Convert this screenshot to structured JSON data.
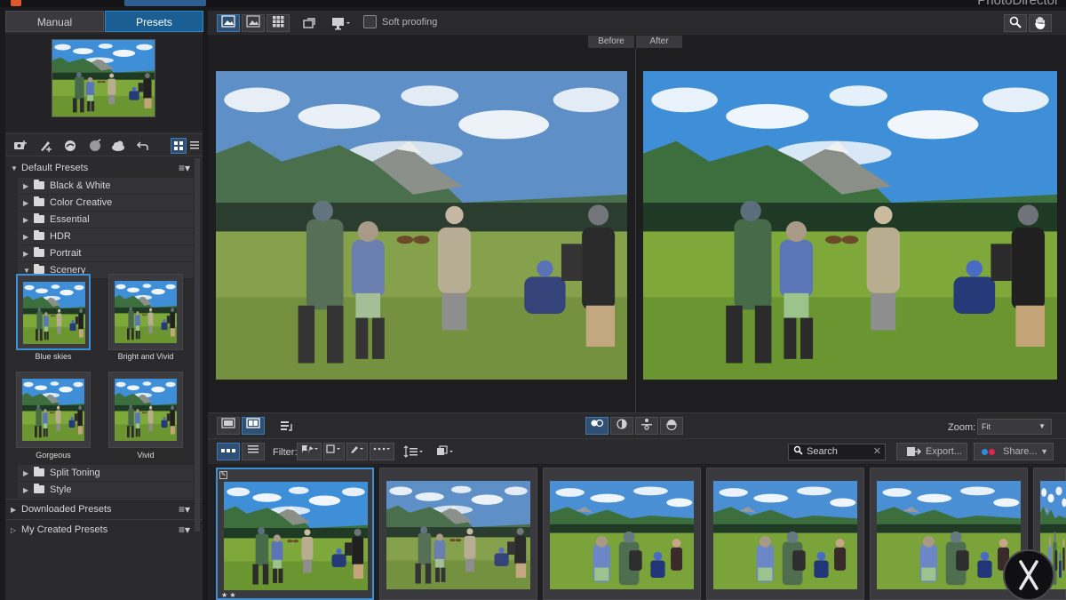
{
  "app": {
    "title": "PhotoDirector"
  },
  "left_panel": {
    "tabs": [
      {
        "label": "Manual"
      },
      {
        "label": "Presets"
      }
    ],
    "sections": {
      "default": "Default Presets",
      "downloaded": "Downloaded Presets",
      "created": "My Created Presets"
    },
    "folders": [
      {
        "label": "Black & White"
      },
      {
        "label": "Color Creative"
      },
      {
        "label": "Essential"
      },
      {
        "label": "HDR"
      },
      {
        "label": "Portrait"
      },
      {
        "label": "Scenery"
      },
      {
        "label": "Split Toning"
      },
      {
        "label": "Style"
      }
    ],
    "presets": [
      {
        "label": "Blue skies"
      },
      {
        "label": "Bright and Vivid"
      },
      {
        "label": "Gorgeous"
      },
      {
        "label": "Vivid"
      }
    ]
  },
  "toolbar": {
    "soft_proofing": "Soft proofing"
  },
  "viewer": {
    "before_label": "Before",
    "after_label": "After"
  },
  "compare": {
    "zoom_label": "Zoom:",
    "zoom_value": "Fit"
  },
  "strip_toolbar": {
    "filter_label": "Filter:",
    "search_placeholder": "Search",
    "export_label": "Export...",
    "share_label": "Share..."
  },
  "filmstrip": {
    "first_stars": "★ ★"
  },
  "colors": {
    "accent": "#3a8fd8",
    "share_red": "#e0244b",
    "share_blue": "#2f8be0"
  }
}
